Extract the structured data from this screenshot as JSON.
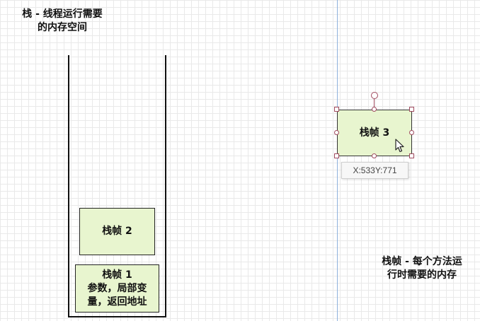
{
  "labels": {
    "stack_caption": [
      "栈 - 线程运行需要",
      "的内存空间"
    ],
    "frame_caption": [
      "栈帧 - 每个方法运",
      "行时需要的内存"
    ]
  },
  "frames": {
    "frame1": [
      "栈帧 1",
      "参数，局部变",
      "量，返回地址"
    ],
    "frame2": "栈帧 2",
    "frame3": "栈帧 3"
  },
  "tooltip": {
    "x_label": "X:",
    "x_value": "533",
    "y_label": "Y:",
    "y_value": "771"
  },
  "colors": {
    "frame_fill": "#e8f5cf",
    "handle_stroke": "#a04a5e",
    "guide_line": "#8fb2dc"
  },
  "icons": [
    "mouse-pointer-icon"
  ]
}
